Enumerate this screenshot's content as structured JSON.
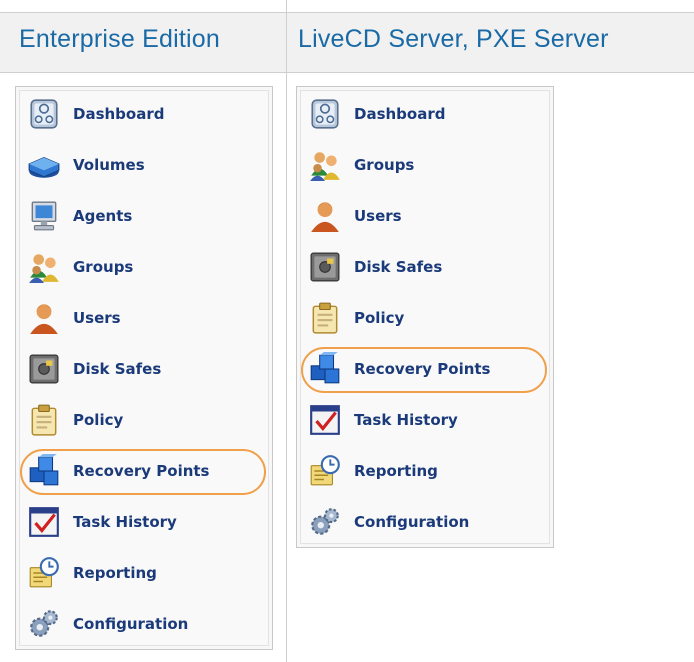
{
  "columns": [
    {
      "title": "Enterprise Edition"
    },
    {
      "title": "LiveCD Server, PXE Server"
    }
  ],
  "menus": [
    {
      "items": [
        {
          "label": "Dashboard",
          "icon": "dashboard-icon"
        },
        {
          "label": "Volumes",
          "icon": "volumes-icon"
        },
        {
          "label": "Agents",
          "icon": "agents-icon"
        },
        {
          "label": "Groups",
          "icon": "groups-icon"
        },
        {
          "label": "Users",
          "icon": "users-icon"
        },
        {
          "label": "Disk Safes",
          "icon": "disk-safes-icon"
        },
        {
          "label": "Policy",
          "icon": "policy-icon"
        },
        {
          "label": "Recovery Points",
          "icon": "recovery-points-icon",
          "highlighted": true
        },
        {
          "label": "Task History",
          "icon": "task-history-icon"
        },
        {
          "label": "Reporting",
          "icon": "reporting-icon"
        },
        {
          "label": "Configuration",
          "icon": "configuration-icon"
        }
      ]
    },
    {
      "items": [
        {
          "label": "Dashboard",
          "icon": "dashboard-icon"
        },
        {
          "label": "Groups",
          "icon": "groups-icon"
        },
        {
          "label": "Users",
          "icon": "users-icon"
        },
        {
          "label": "Disk Safes",
          "icon": "disk-safes-icon"
        },
        {
          "label": "Policy",
          "icon": "policy-icon"
        },
        {
          "label": "Recovery Points",
          "icon": "recovery-points-icon",
          "highlighted": true
        },
        {
          "label": "Task History",
          "icon": "task-history-icon"
        },
        {
          "label": "Reporting",
          "icon": "reporting-icon"
        },
        {
          "label": "Configuration",
          "icon": "configuration-icon"
        }
      ]
    }
  ],
  "colors": {
    "title": "#1a6aa6",
    "menu_label": "#1b3a7a",
    "highlight": "#f0a04a",
    "header_bg": "#f1f1f1"
  }
}
